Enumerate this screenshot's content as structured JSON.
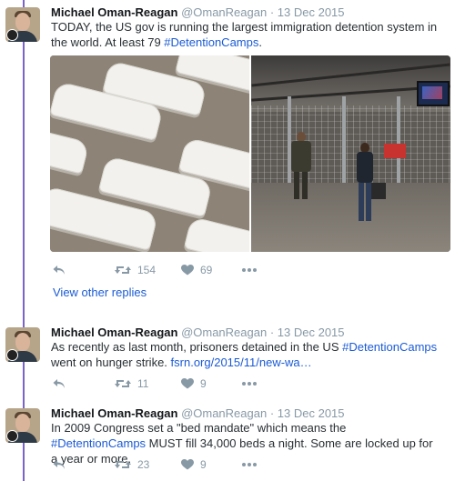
{
  "thread": {
    "first_tweet": {
      "author_name": "Michael Oman-Reagan",
      "handle": "@OmanReagan",
      "separator": "·",
      "date": "13 Dec 2015",
      "text_before": "TODAY, the US gov is running the largest immigration detention system in the world. At least 79 ",
      "hashtag": "#DetentionCamps",
      "text_after": ".",
      "retweet_count": "154",
      "like_count": "69",
      "media": [
        {
          "subject": "aerial view of white tents"
        },
        {
          "subject": "guard and child in detention facility"
        }
      ]
    },
    "view_other_replies": "View other replies",
    "second_tweet": {
      "author_name": "Michael Oman-Reagan",
      "handle": "@OmanReagan",
      "separator": "·",
      "date": "13 Dec 2015",
      "text_before": "As recently as last month, prisoners detained in the US ",
      "hashtag": "#DetentionCamps",
      "text_middle": " went on hunger strike. ",
      "link": "fsrn.org/2015/11/new-wa…",
      "retweet_count": "11",
      "like_count": "9"
    },
    "third_tweet": {
      "author_name": "Michael Oman-Reagan",
      "handle": "@OmanReagan",
      "separator": "·",
      "date": "13 Dec 2015",
      "text_before": "In 2009 Congress set a \"bed mandate\" which means the ",
      "hashtag": "#DetentionCamps",
      "text_after": " MUST fill 34,000 beds a night. Some are locked up for a year or more.",
      "retweet_count": "23",
      "like_count": "9"
    }
  },
  "icons": {
    "reply": "reply-icon",
    "retweet": "retweet-icon",
    "like": "heart-icon",
    "more": "more-icon"
  },
  "colors": {
    "thread_line": "#7a63c9",
    "link": "#1b5bd6",
    "muted": "#8899a6"
  }
}
